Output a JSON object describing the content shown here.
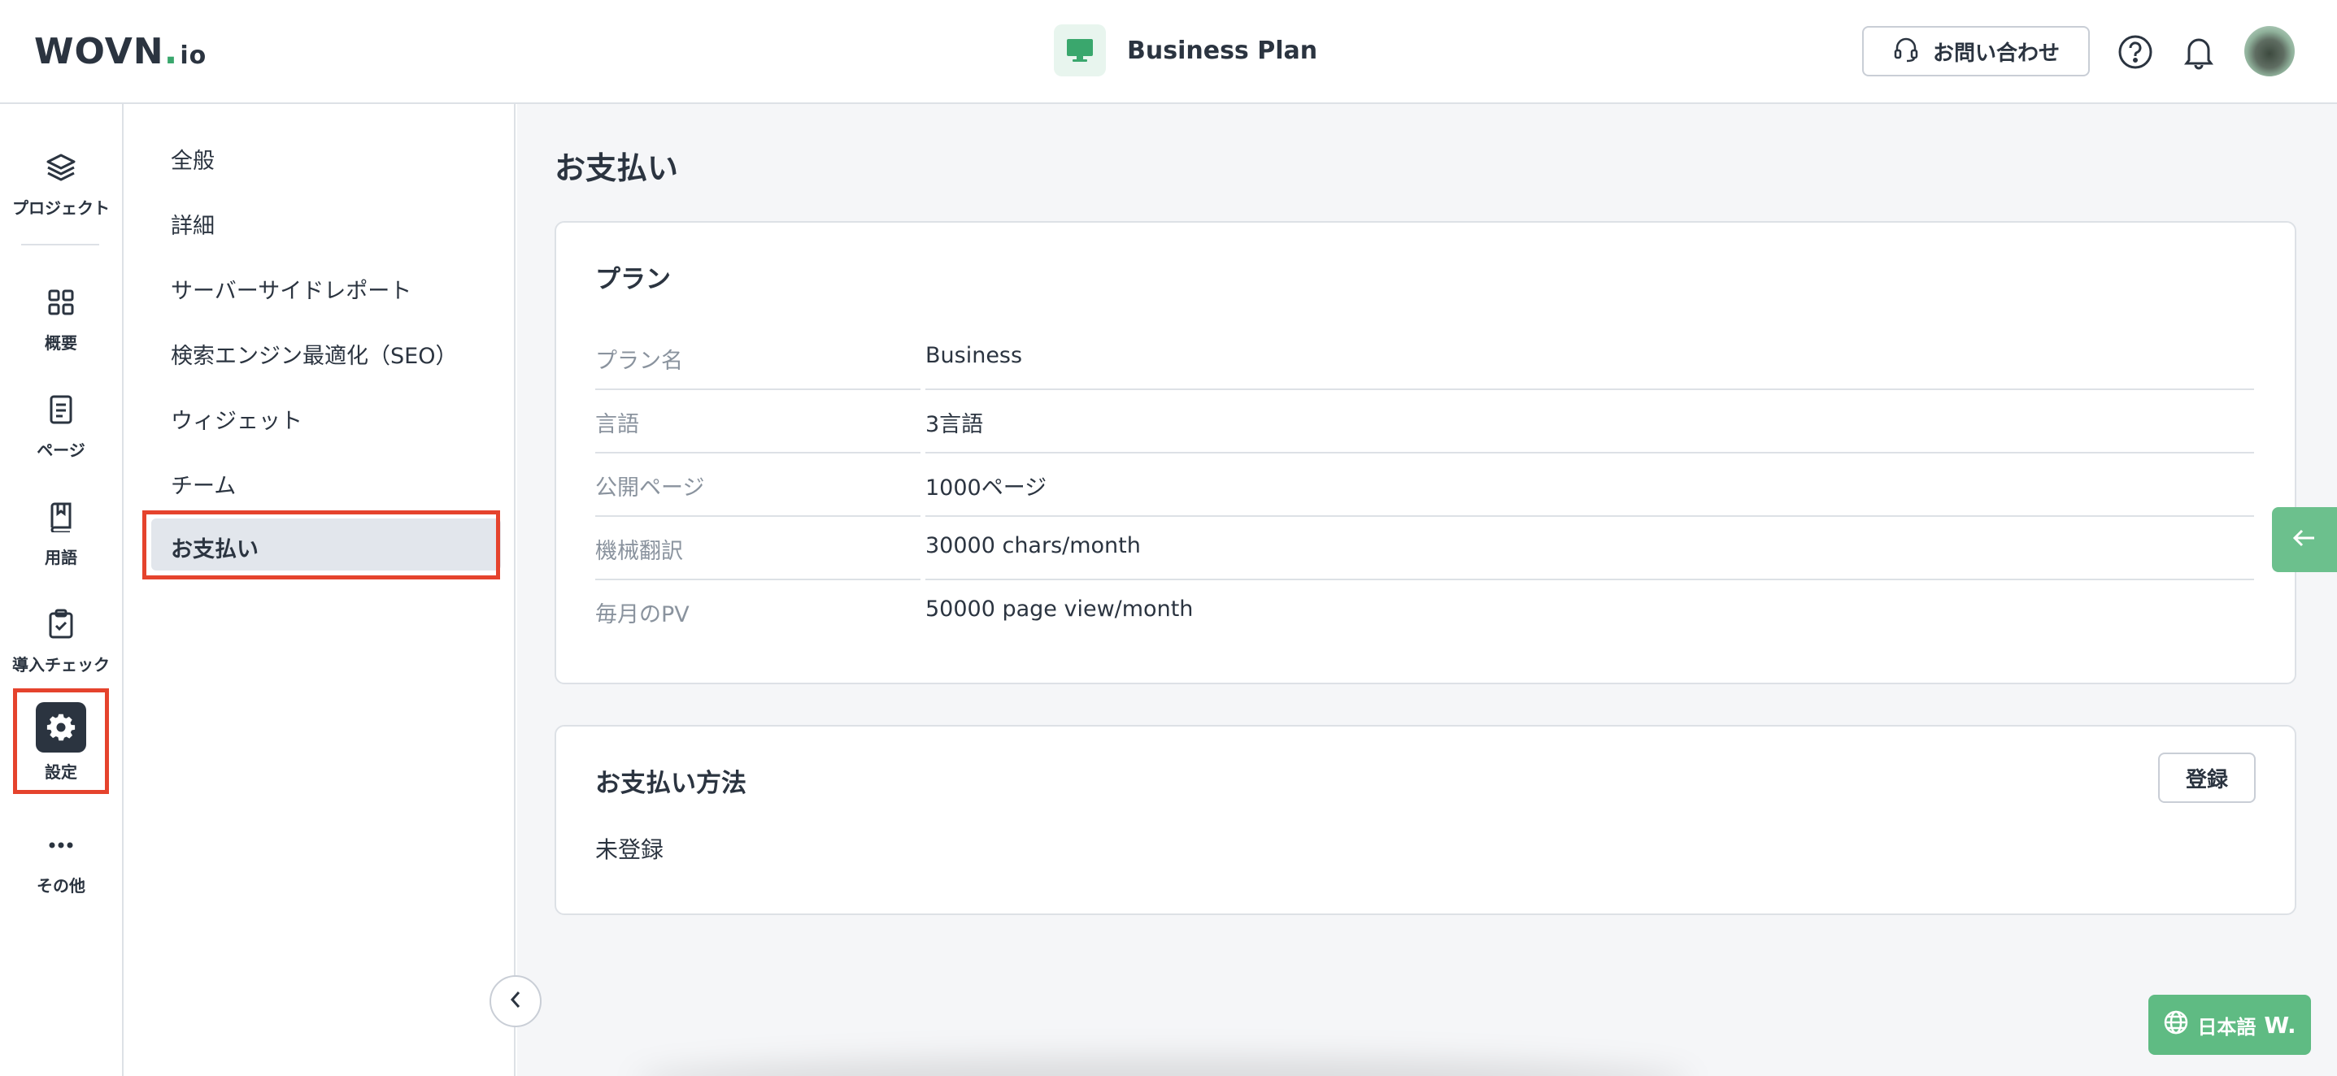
{
  "header": {
    "logo": {
      "main": "WOVN",
      "dot": ".",
      "suffix": "io"
    },
    "plan_name": "Business Plan",
    "contact_label": "お問い合わせ"
  },
  "rail": {
    "project_label": "プロジェクト",
    "items": [
      {
        "label": "概要",
        "icon": "grid-icon"
      },
      {
        "label": "ページ",
        "icon": "document-icon"
      },
      {
        "label": "用語",
        "icon": "book-icon"
      },
      {
        "label": "導入チェック",
        "icon": "clipboard-check-icon"
      },
      {
        "label": "設定",
        "icon": "gear-icon",
        "active": true
      },
      {
        "label": "その他",
        "icon": "more-icon"
      }
    ]
  },
  "subnav": {
    "items": [
      {
        "label": "全般"
      },
      {
        "label": "詳細"
      },
      {
        "label": "サーバーサイドレポート"
      },
      {
        "label": "検索エンジン最適化（SEO）"
      },
      {
        "label": "ウィジェット"
      },
      {
        "label": "チーム"
      },
      {
        "label": "お支払い",
        "active": true
      }
    ]
  },
  "main": {
    "title": "お支払い",
    "plan_card": {
      "title": "プラン",
      "rows": [
        {
          "key": "プラン名",
          "value": "Business"
        },
        {
          "key": "言語",
          "value": "3言語"
        },
        {
          "key": "公開ページ",
          "value": "1000ページ"
        },
        {
          "key": "機械翻訳",
          "value": "30000 chars/month"
        },
        {
          "key": "毎月のPV",
          "value": "50000 page view/month"
        }
      ]
    },
    "payment_card": {
      "title": "お支払い方法",
      "register_label": "登録",
      "status": "未登録"
    }
  },
  "widget": {
    "language": "日本語",
    "brand": "W."
  },
  "colors": {
    "accent_green": "#3aa76d",
    "highlight_red": "#e5432d",
    "text_dark": "#2b3440",
    "muted": "#8a939e"
  }
}
